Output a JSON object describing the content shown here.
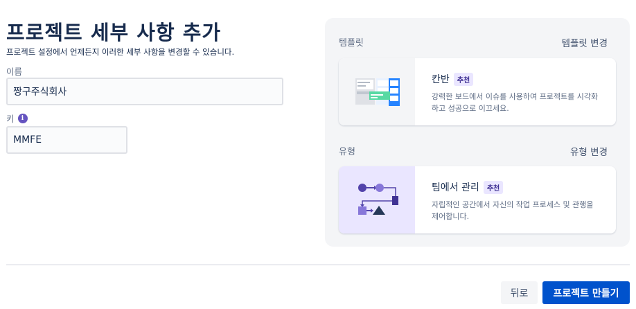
{
  "header": {
    "title": "프로젝트 세부 사항 추가",
    "subtitle": "프로젝트 설정에서 언제든지 이러한 세부 사항을 변경할 수 있습니다."
  },
  "form": {
    "name_label": "이름",
    "name_value": "짱구주식회사",
    "key_label": "키",
    "key_value": "MMFE",
    "info_glyph": "i"
  },
  "template_section": {
    "label": "템플릿",
    "change_link": "템플릿 변경",
    "card": {
      "title": "칸반",
      "badge": "추천",
      "description": "강력한 보드에서 이슈를 사용하여 프로젝트를 시각화하고 성공으로 이끄세요."
    }
  },
  "type_section": {
    "label": "유형",
    "change_link": "유형 변경",
    "card": {
      "title": "팀에서 관리",
      "badge": "추천",
      "description": "자립적인 공간에서 자신의 작업 프로세스 및 관행을 제어합니다."
    }
  },
  "footer": {
    "back_label": "뒤로",
    "create_label": "프로젝트 만들기"
  },
  "colors": {
    "primary": "#0052cc",
    "badge_bg": "#eae6ff",
    "info_icon": "#6554c0"
  }
}
